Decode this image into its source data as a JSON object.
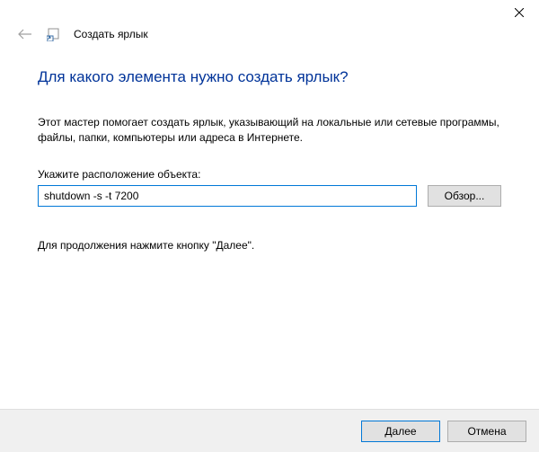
{
  "window": {
    "wizard_title": "Создать ярлык"
  },
  "content": {
    "heading": "Для какого элемента нужно создать ярлык?",
    "description": "Этот мастер помогает создать ярлык, указывающий на локальные или сетевые программы, файлы, папки, компьютеры или адреса в Интернете.",
    "field_label": "Укажите расположение объекта:",
    "location_value": "shutdown -s -t 7200",
    "browse_label": "Обзор...",
    "hint": "Для продолжения нажмите кнопку \"Далее\"."
  },
  "footer": {
    "next_label": "Далее",
    "cancel_label": "Отмена"
  }
}
